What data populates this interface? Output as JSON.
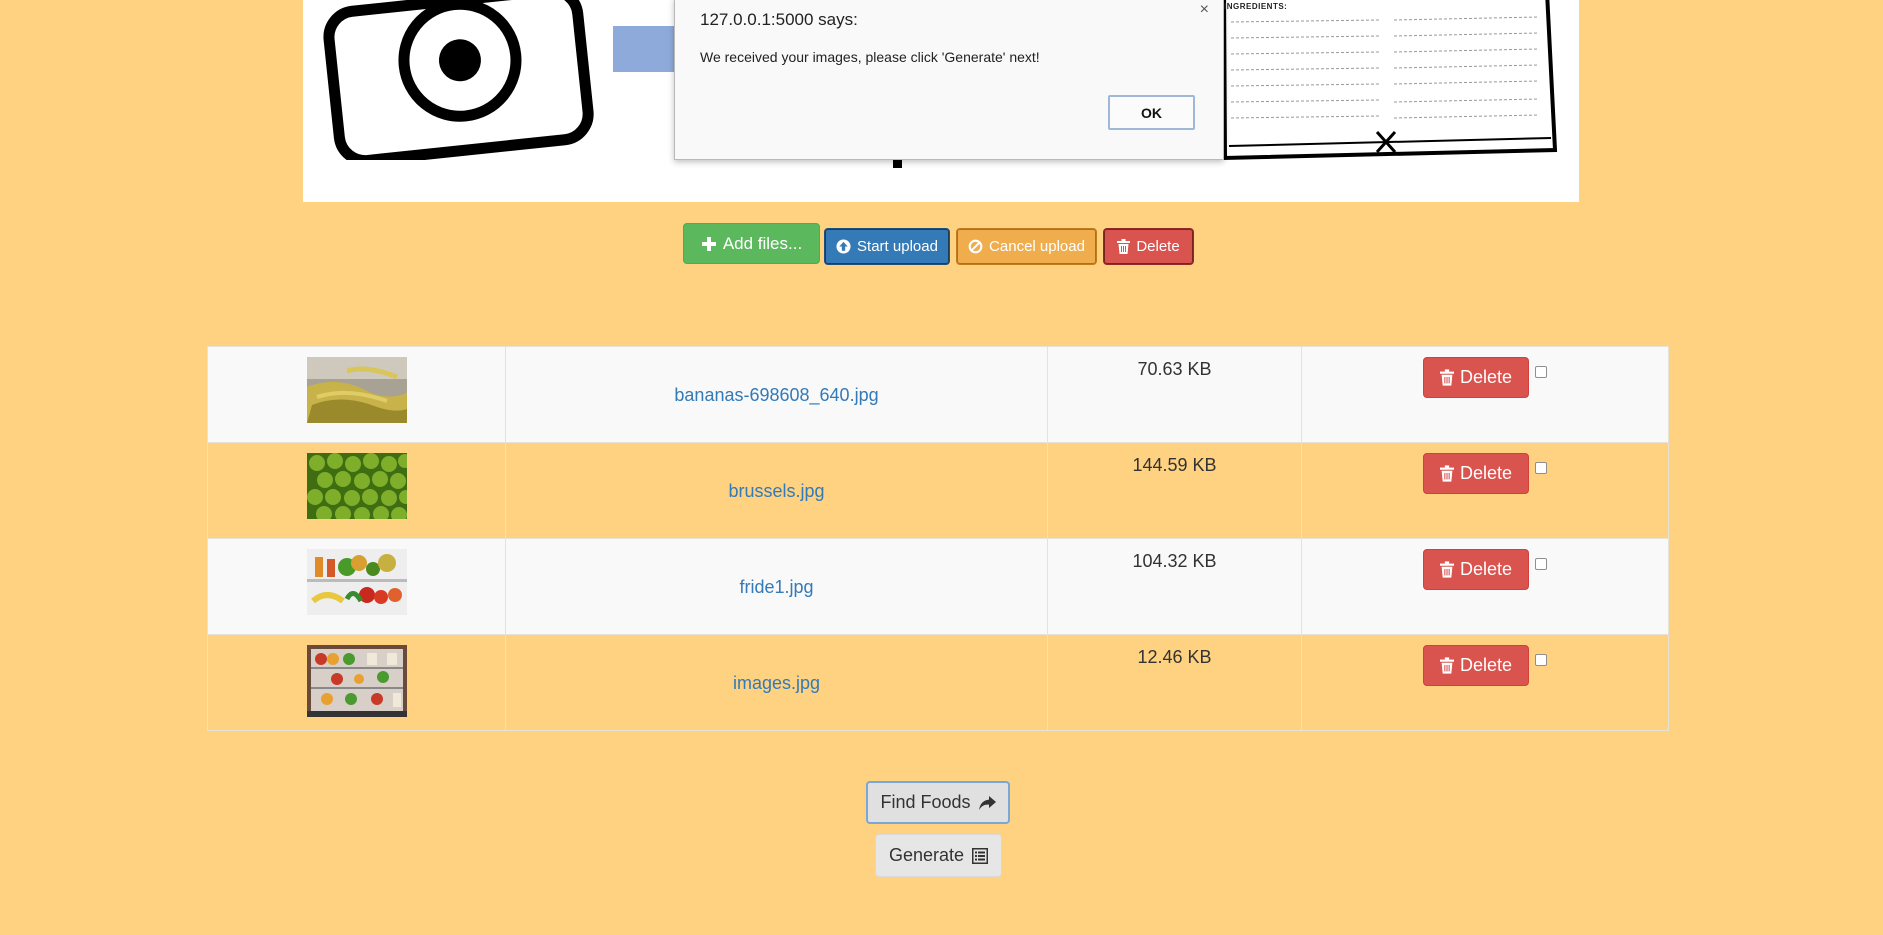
{
  "dialog": {
    "title": "127.0.0.1:5000 says:",
    "message": "We received your images, please click 'Generate' next!",
    "ok_label": "OK",
    "close_glyph": "×"
  },
  "banner": {
    "recipe_label": "INGREDIENTS:",
    "icons": [
      "camera-icon",
      "fork-knife-icon"
    ]
  },
  "toolbar": {
    "add_label": "Add files...",
    "start_label": "Start upload",
    "cancel_label": "Cancel upload",
    "delete_label": "Delete",
    "colors": {
      "add": "#5cb85c",
      "start": "#337ab7",
      "cancel": "#f0ad4e",
      "delete": "#d9534f"
    }
  },
  "files": {
    "rows": [
      {
        "name": "bananas-698608_640.jpg",
        "size": "70.63 KB",
        "delete_label": "Delete",
        "thumb": "bananas"
      },
      {
        "name": "brussels.jpg",
        "size": "144.59 KB",
        "delete_label": "Delete",
        "thumb": "brussels"
      },
      {
        "name": "fride1.jpg",
        "size": "104.32 KB",
        "delete_label": "Delete",
        "thumb": "fridge-produce"
      },
      {
        "name": "images.jpg",
        "size": "12.46 KB",
        "delete_label": "Delete",
        "thumb": "open-fridge"
      }
    ]
  },
  "actions": {
    "find_label": "Find Foods",
    "generate_label": "Generate"
  },
  "colors": {
    "page_bg": "#fed280",
    "link": "#337ab7"
  }
}
